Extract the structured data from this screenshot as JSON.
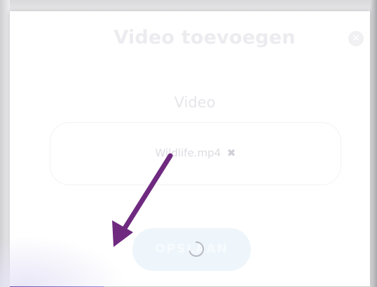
{
  "dialog": {
    "title": "Video toevoegen",
    "close_icon": "close-icon",
    "field_label": "Video",
    "file": {
      "name": "Wildlife.mp4",
      "remove_glyph": "✖"
    },
    "save_label": "OPSLAAN",
    "loading": true
  },
  "upload_progress": {
    "fraction": 0.26,
    "colors": {
      "start": "#6d4fb5",
      "end": "#9a8fdc",
      "track": "#c8ced3"
    }
  },
  "annotation": {
    "arrow_color": "#6f2a80"
  }
}
